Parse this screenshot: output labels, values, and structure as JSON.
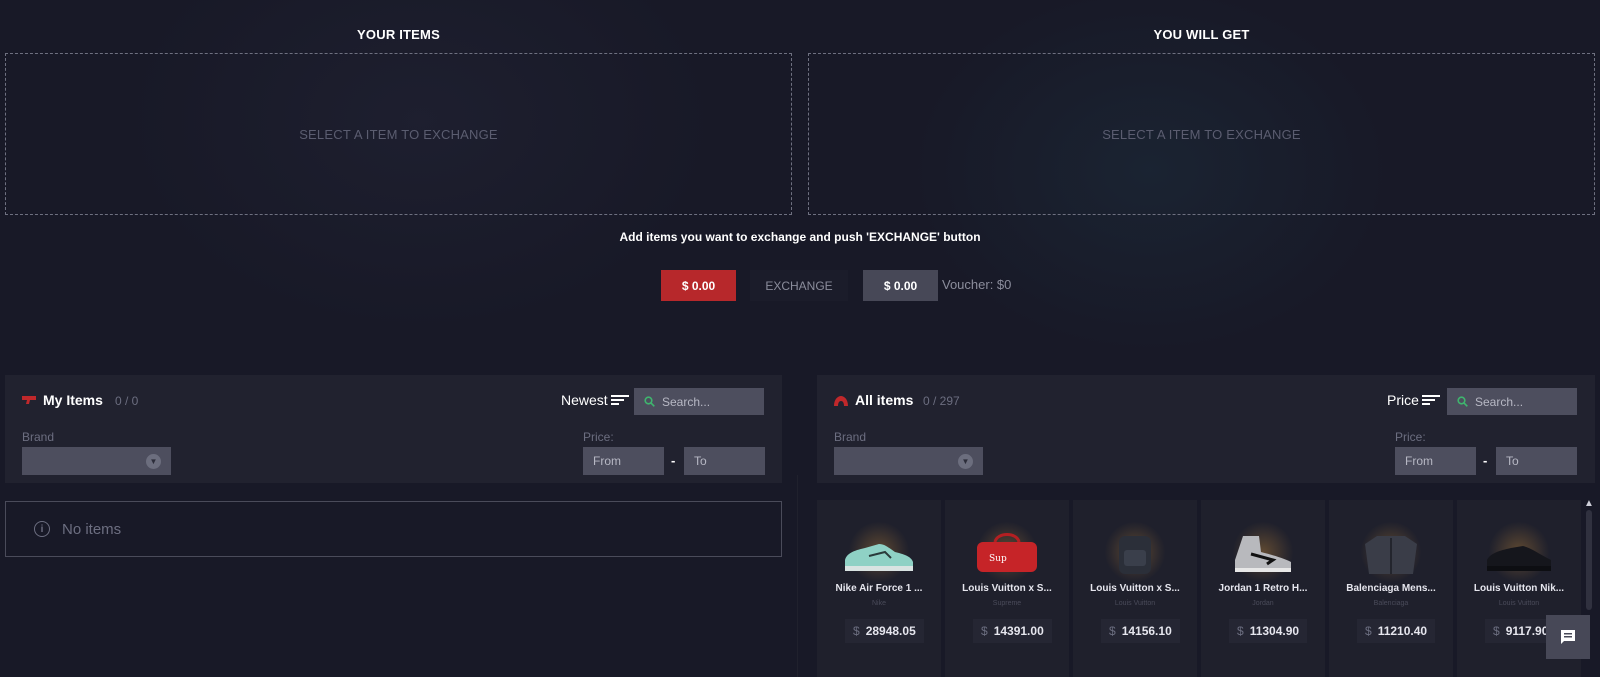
{
  "exchange": {
    "your_items_title": "YOUR ITEMS",
    "you_will_get_title": "YOU WILL GET",
    "left_placeholder": "SELECT A ITEM TO EXCHANGE",
    "right_placeholder": "SELECT A ITEM TO EXCHANGE",
    "hint": "Add items you want to exchange and push 'EXCHANGE' button",
    "your_total": "$ 0.00",
    "exchange_label": "EXCHANGE",
    "get_total": "$ 0.00",
    "voucher": "Voucher: $0"
  },
  "my_items": {
    "title": "My Items",
    "count": "0 / 0",
    "sort_label": "Newest",
    "search_placeholder": "Search...",
    "brand_label": "Brand",
    "price_label": "Price:",
    "from_placeholder": "From",
    "to_placeholder": "To",
    "dash": "-",
    "empty_text": "No items"
  },
  "all_items": {
    "title": "All items",
    "count": "0 / 297",
    "sort_label": "Price",
    "search_placeholder": "Search...",
    "brand_label": "Brand",
    "price_label": "Price:",
    "from_placeholder": "From",
    "to_placeholder": "To",
    "dash": "-",
    "currency": "$",
    "products": [
      {
        "name": "Nike Air Force 1 ...",
        "brand": "Nike",
        "price": "28948.05"
      },
      {
        "name": "Louis Vuitton x S...",
        "brand": "Supreme",
        "price": "14391.00"
      },
      {
        "name": "Louis Vuitton x S...",
        "brand": "Louis Vuitton",
        "price": "14156.10"
      },
      {
        "name": "Jordan 1 Retro H...",
        "brand": "Jordan",
        "price": "11304.90"
      },
      {
        "name": "Balenciaga Mens...",
        "brand": "Balenciaga",
        "price": "11210.40"
      },
      {
        "name": "Louis Vuitton Nik...",
        "brand": "Louis Vuitton",
        "price": "9117.90"
      }
    ]
  },
  "colors": {
    "accent_red": "#b7282b",
    "background": "#181927",
    "panel": "#21222f",
    "input": "#4d4e5e"
  }
}
